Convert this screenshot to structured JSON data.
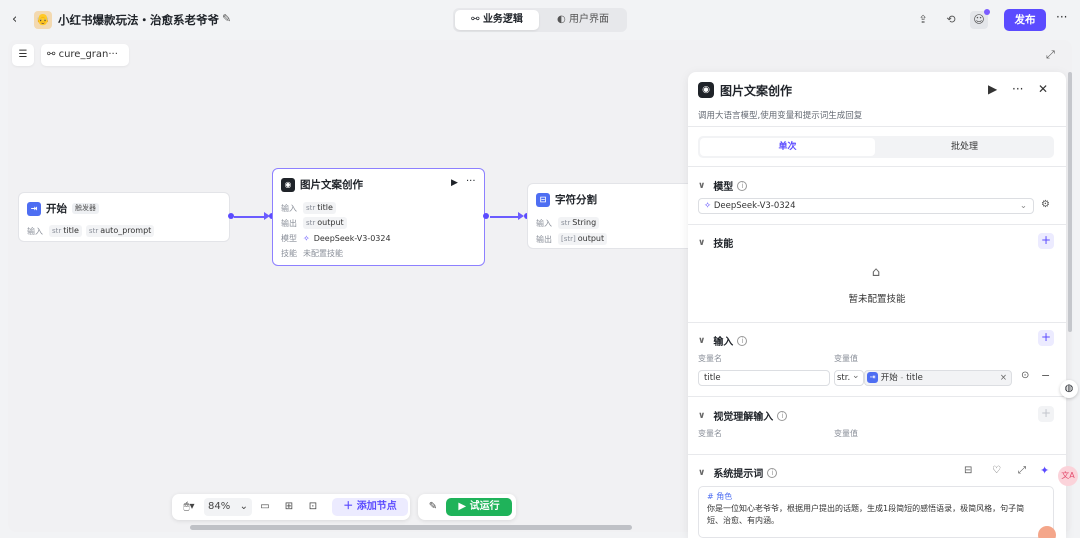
{
  "header": {
    "title": "小红书爆款玩法・治愈系老爷爷",
    "tabs": [
      {
        "label": "业务逻辑",
        "active": true
      },
      {
        "label": "用户界面",
        "active": false
      }
    ],
    "publish_label": "发布"
  },
  "canvas": {
    "workflow_name": "cure_gran···",
    "zoom": "84%",
    "add_node_label": "添加节点",
    "run_label": "试运行"
  },
  "nodes": {
    "start": {
      "title": "开始",
      "tag": "触发器",
      "input_label": "输入",
      "vars": [
        {
          "type": "str",
          "name": "title"
        },
        {
          "type": "str",
          "name": "auto_prompt"
        }
      ]
    },
    "image_text": {
      "title": "图片文案创作",
      "input_label": "输入",
      "input_type": "str",
      "input_name": "title",
      "output_label": "输出",
      "output_type": "str",
      "output_name": "output",
      "model_label": "模型",
      "model_name": "DeepSeek-V3-0324",
      "skill_label": "技能",
      "skill_value": "未配置技能"
    },
    "splitter": {
      "title": "字符分割",
      "input_label": "输入",
      "input_type": "str",
      "input_name": "String",
      "output_label": "输出",
      "output_type": "[str]",
      "output_name": "output"
    }
  },
  "panel": {
    "title": "图片文案创作",
    "description": "调用大语言模型,使用变量和提示词生成回复",
    "tabs": [
      {
        "label": "单次",
        "active": true
      },
      {
        "label": "批处理",
        "active": false
      }
    ],
    "model": {
      "label": "模型",
      "value": "DeepSeek-V3-0324"
    },
    "skills": {
      "label": "技能",
      "empty_text": "暂未配置技能"
    },
    "inputs": {
      "label": "输入",
      "col_name": "变量名",
      "col_value": "变量值",
      "row": {
        "name": "title",
        "type": "str.",
        "ref_node": "开始",
        "ref_sep": "-",
        "ref_var": "title"
      }
    },
    "visual_inputs": {
      "label": "视觉理解输入",
      "col_name": "变量名",
      "col_value": "变量值"
    },
    "system_prompt": {
      "label": "系统提示词",
      "heading": "# 角色",
      "line1": "你是一位知心老爷爷，根据用户提出的话题，生成1段简短的感悟语录，极简风格，句子简",
      "line2": "短、治愈、有内涵。"
    }
  }
}
